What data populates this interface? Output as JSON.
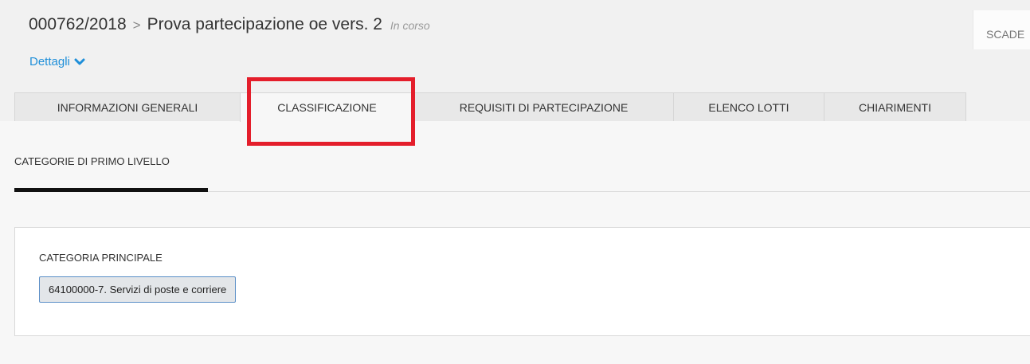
{
  "header": {
    "code": "000762/2018",
    "separator": ">",
    "title": "Prova partecipazione oe vers. 2",
    "status": "In corso",
    "details_label": "Dettagli",
    "deadline_label": "SCADE"
  },
  "tabs": [
    {
      "label": "INFORMAZIONI GENERALI",
      "active": false
    },
    {
      "label": "CLASSIFICAZIONE",
      "active": true
    },
    {
      "label": "REQUISITI DI PARTECIPAZIONE",
      "active": false
    },
    {
      "label": "ELENCO LOTTI",
      "active": false
    },
    {
      "label": "CHIARIMENTI",
      "active": false
    }
  ],
  "subtabs": [
    {
      "label": "CATEGORIE DI PRIMO LIVELLO",
      "active": true
    }
  ],
  "panel": {
    "label": "CATEGORIA PRINCIPALE",
    "category": "64100000-7. Servizi di poste e corriere"
  },
  "colors": {
    "link": "#1f8fd9",
    "highlight": "#e41e2b",
    "chip_border": "#5b8fc7",
    "active_underline": "#111111"
  },
  "icons": {
    "details_toggle": "chevron-down-icon"
  }
}
